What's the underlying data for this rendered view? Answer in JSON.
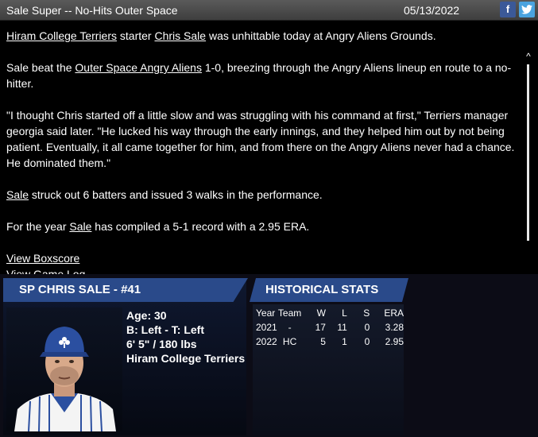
{
  "header": {
    "title": "Sale Super -- No-Hits Outer Space",
    "date": "05/13/2022",
    "facebook_label": "f",
    "twitter_label": "🐦"
  },
  "story": {
    "p1": {
      "team_link": "Hiram College Terriers",
      "mid1": " starter ",
      "player_link": "Chris Sale",
      "rest": " was unhittable today at Angry Aliens  Grounds."
    },
    "p2": {
      "lead": "Sale beat the ",
      "opp_link": "Outer Space Angry Aliens",
      "rest": " 1-0, breezing through the Angry Aliens lineup en route to a no-hitter."
    },
    "p3": "\"I thought Chris started off a little slow and was struggling with his command at first,\" Terriers manager   georgia said later. \"He lucked his way through the early innings, and they helped him out by not being patient. Eventually, it all came together for him, and from there on the Angry Aliens never had a chance. He dominated them.\"",
    "p4": {
      "player_link": "Sale",
      "rest": " struck out 6 batters and issued 3 walks in the performance."
    },
    "p5": {
      "lead": "For the year ",
      "player_link": "Sale",
      "rest": " has compiled a 5-1 record with a 2.95 ERA."
    },
    "links": [
      "View Boxscore",
      "View Game Log"
    ]
  },
  "scroll": {
    "up": "^",
    "down": "v"
  },
  "player": {
    "banner": "SP CHRIS SALE - #41",
    "age": "Age: 30",
    "bats_throws": "B: Left - T: Left",
    "height_weight": "6' 5\" / 180 lbs",
    "team": "Hiram College Terriers"
  },
  "stats": {
    "banner": "HISTORICAL STATS",
    "headers": [
      "Year",
      "Team",
      "W",
      "L",
      "S",
      "ERA"
    ],
    "rows": [
      [
        "2021",
        "-",
        "17",
        "11",
        "0",
        "3.28"
      ],
      [
        "2022",
        "HC",
        "5",
        "1",
        "0",
        "2.95"
      ]
    ]
  },
  "colors": {
    "banner": "#2a4a8a",
    "titlebar": "#4a4a4a",
    "facebook": "#3b5998",
    "twitter": "#4aa3df"
  }
}
